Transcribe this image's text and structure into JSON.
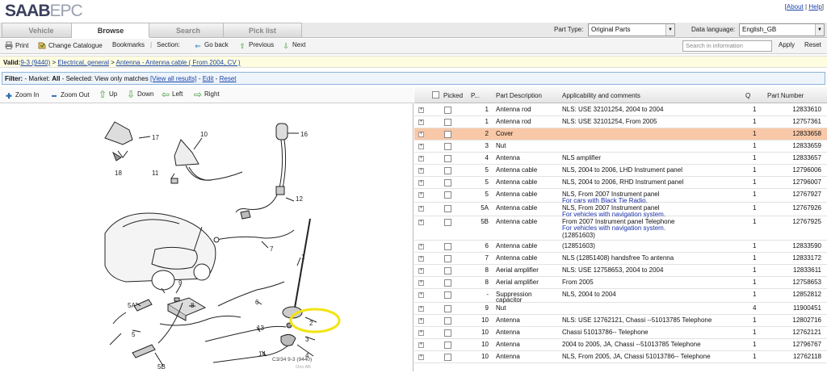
{
  "app": {
    "logo_bold": "SAAB",
    "logo_light": "EPC"
  },
  "top_links": {
    "open": "[",
    "about": "About",
    "sep": "|",
    "help": "Help",
    "close": "]"
  },
  "tabs": [
    {
      "label": "Vehicle",
      "active": false
    },
    {
      "label": "Browse",
      "active": true
    },
    {
      "label": "Search",
      "active": false
    },
    {
      "label": "Pick list",
      "active": false
    }
  ],
  "part_type": {
    "label": "Part Type:",
    "value": "Original Parts"
  },
  "data_language": {
    "label": "Data language:",
    "value": "English_GB"
  },
  "toolbar": {
    "print": "Print",
    "change_catalogue": "Change Catalogue",
    "bookmarks": "Bookmarks",
    "section_label": "Section:",
    "go_back": "Go back",
    "previous": "Previous",
    "next": "Next",
    "search_placeholder": "Search in information",
    "apply": "Apply",
    "reset": "Reset"
  },
  "valid": {
    "prefix": "Valid:",
    "model": "9-3 (9440)",
    "sep1": " > ",
    "group": "Electrical, general",
    "sep2": " > ",
    "section": "Antenna - Antenna cable ( From 2004, CV )"
  },
  "filter": {
    "label": "Filter:",
    "market_label": " - Market: ",
    "market": "All",
    "selected_label": " - Selected: ",
    "selected": "View only matches ",
    "view_all": "[View all results]",
    "dash1": " - ",
    "edit": "Edit",
    "dash2": " - ",
    "reset": "Reset"
  },
  "image_tools": {
    "zoom_in": "Zoom In",
    "zoom_out": "Zoom Out",
    "up": "Up",
    "down": "Down",
    "left": "Left",
    "right": "Right"
  },
  "diagram": {
    "caption": "C3/34 9-3 (9440)",
    "copyright": "Orio AB",
    "callouts": [
      "17",
      "10",
      "16",
      "18",
      "11",
      "12",
      "7",
      "1",
      "9",
      "8",
      "6",
      "5A",
      "2",
      "13",
      "3",
      "5",
      "4",
      "14",
      "5B"
    ]
  },
  "table": {
    "headers": {
      "picked": "Picked",
      "pos": "P...",
      "description": "Part Description",
      "applicability": "Applicability and comments",
      "qty": "Q",
      "part_number": "Part Number"
    },
    "rows": [
      {
        "pos": "1",
        "desc": "Antenna rod",
        "app": "NLS: USE 32101254, 2004 to 2004",
        "note": "",
        "qty": "1",
        "pn": "12833610",
        "hl": false
      },
      {
        "pos": "1",
        "desc": "Antenna rod",
        "app": "NLS: USE 32101254, From 2005",
        "note": "",
        "qty": "1",
        "pn": "12757361",
        "hl": false
      },
      {
        "pos": "2",
        "desc": "Cover",
        "app": "",
        "note": "",
        "qty": "1",
        "pn": "12833658",
        "hl": true
      },
      {
        "pos": "3",
        "desc": "Nut",
        "app": "",
        "note": "",
        "qty": "1",
        "pn": "12833659",
        "hl": false
      },
      {
        "pos": "4",
        "desc": "Antenna",
        "app": "NLS amplifier",
        "note": "",
        "qty": "1",
        "pn": "12833657",
        "hl": false
      },
      {
        "pos": "5",
        "desc": "Antenna cable",
        "app": "NLS, 2004 to 2006, LHD Instrument panel",
        "note": "",
        "qty": "1",
        "pn": "12796006",
        "hl": false
      },
      {
        "pos": "5",
        "desc": "Antenna cable",
        "app": "NLS, 2004 to 2006, RHD Instrument panel",
        "note": "",
        "qty": "1",
        "pn": "12796007",
        "hl": false
      },
      {
        "pos": "5",
        "desc": "Antenna cable",
        "app": "NLS, From 2007 Instrument panel",
        "note": "For cars with Black Tie Radio.",
        "qty": "1",
        "pn": "12767927",
        "hl": false
      },
      {
        "pos": "5A",
        "desc": "Antenna cable",
        "app": "NLS, From 2007 Instrument panel",
        "note": "For vehicles with navigation system.",
        "qty": "1",
        "pn": "12767926",
        "hl": false
      },
      {
        "pos": "5B",
        "desc": "Antenna cable",
        "app": "From 2007 Instrument panel Telephone",
        "note": "For vehicles with navigation system.",
        "app2": "(12851603)",
        "qty": "1",
        "pn": "12767925",
        "hl": false
      },
      {
        "pos": "6",
        "desc": "Antenna cable",
        "app": "(12851603)",
        "note": "",
        "qty": "1",
        "pn": "12833590",
        "hl": false,
        "hide_app": true
      },
      {
        "pos": "7",
        "desc": "Antenna cable",
        "app": "NLS (12851408) handsfree To antenna",
        "note": "",
        "qty": "1",
        "pn": "12833172",
        "hl": false
      },
      {
        "pos": "8",
        "desc": "Aerial amplifier",
        "app": "NLS: USE 12758653, 2004 to 2004",
        "note": "",
        "qty": "1",
        "pn": "12833611",
        "hl": false
      },
      {
        "pos": "8",
        "desc": "Aerial amplifier",
        "app": "From 2005",
        "note": "",
        "qty": "1",
        "pn": "12758653",
        "hl": false
      },
      {
        "pos": "-",
        "desc": "Suppression",
        "desc2": "capacitor",
        "app": "NLS, 2004 to 2004",
        "note": "",
        "qty": "1",
        "pn": "12852812",
        "hl": false
      },
      {
        "pos": "9",
        "desc": "Nut",
        "app": "",
        "note": "",
        "qty": "4",
        "pn": "11900451",
        "hl": false
      },
      {
        "pos": "10",
        "desc": "Antenna",
        "app": "NLS: USE 12762121, Chassi --51013785 Telephone",
        "note": "",
        "qty": "1",
        "pn": "12802716",
        "hl": false
      },
      {
        "pos": "10",
        "desc": "Antenna",
        "app": "Chassi 51013786-- Telephone",
        "note": "",
        "qty": "1",
        "pn": "12762121",
        "hl": false
      },
      {
        "pos": "10",
        "desc": "Antenna",
        "app": "2004 to 2005, JA, Chassi --51013785 Telephone",
        "note": "",
        "qty": "1",
        "pn": "12796767",
        "hl": false
      },
      {
        "pos": "10",
        "desc": "Antenna",
        "app": "NLS, From 2005, JA, Chassi 51013786-- Telephone",
        "note": "",
        "qty": "1",
        "pn": "12762118",
        "hl": false
      }
    ]
  }
}
